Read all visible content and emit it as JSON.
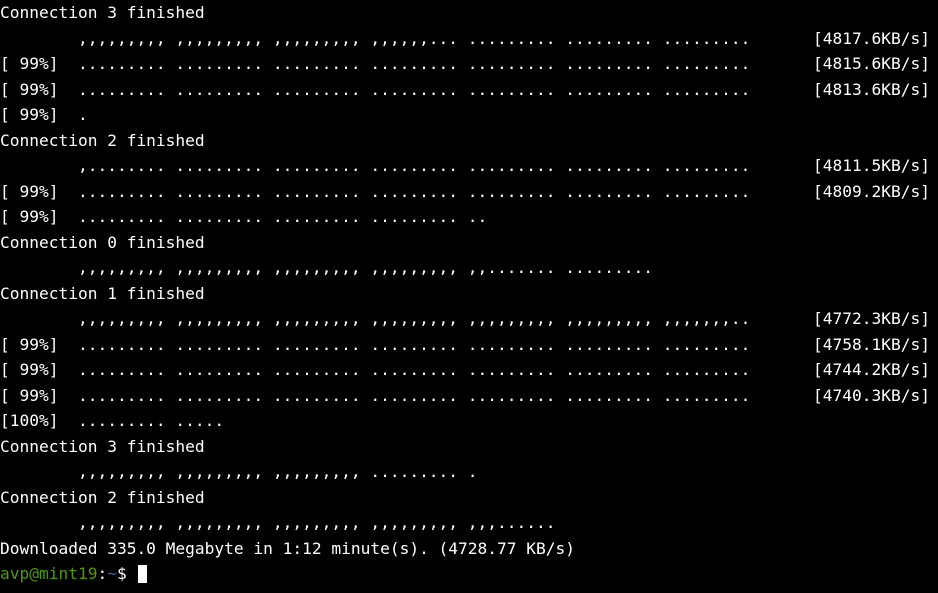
{
  "lines": [
    {
      "left": "Connection 3 finished",
      "right": ""
    },
    {
      "left": "        ,,,,,,,,, ,,,,,,,,, ,,,,,,,,, ,,,,,,... ......... ......... .........",
      "right": "[4817.6KB/s]"
    },
    {
      "left": "[ 99%]  ......... ......... ......... ......... ......... ......... .........",
      "right": "[4815.6KB/s]"
    },
    {
      "left": "[ 99%]  ......... ......... ......... ......... ......... ......... .........",
      "right": "[4813.6KB/s]"
    },
    {
      "left": "[ 99%]  .",
      "right": ""
    },
    {
      "left": "Connection 2 finished",
      "right": ""
    },
    {
      "left": "        ,........ ......... ......... ......... ......... ......... .........",
      "right": "[4811.5KB/s]"
    },
    {
      "left": "[ 99%]  ......... ......... ......... ......... ......... ......... .........",
      "right": "[4809.2KB/s]"
    },
    {
      "left": "[ 99%]  ......... ......... ......... ......... ..",
      "right": ""
    },
    {
      "left": "Connection 0 finished",
      "right": ""
    },
    {
      "left": "        ,,,,,,,,, ,,,,,,,,, ,,,,,,,,, ,,,,,,,,, ,,....... .........",
      "right": ""
    },
    {
      "left": "Connection 1 finished",
      "right": ""
    },
    {
      "left": "        ,,,,,,,,, ,,,,,,,,, ,,,,,,,,, ,,,,,,,,, ,,,,,,,,, ,,,,,,,,, ,,,,,,,..",
      "right": "[4772.3KB/s]"
    },
    {
      "left": "[ 99%]  ......... ......... ......... ......... ......... ......... .........",
      "right": "[4758.1KB/s]"
    },
    {
      "left": "[ 99%]  ......... ......... ......... ......... ......... ......... .........",
      "right": "[4744.2KB/s]"
    },
    {
      "left": "[ 99%]  ......... ......... ......... ......... ......... ......... .........",
      "right": "[4740.3KB/s]"
    },
    {
      "left": "[100%]  ......... .....",
      "right": ""
    },
    {
      "left": "Connection 3 finished",
      "right": ""
    },
    {
      "left": "        ,,,,,,,,, ,,,,,,,,, ,,,,,,,,, ......... .",
      "right": ""
    },
    {
      "left": "Connection 2 finished",
      "right": ""
    },
    {
      "left": "        ,,,,,,,,, ,,,,,,,,, ,,,,,,,,, ,,,,,,,,, ,,,......",
      "right": ""
    },
    {
      "left": "",
      "right": ""
    },
    {
      "left": "Downloaded 335.0 Megabyte in 1:12 minute(s). (4728.77 KB/s)",
      "right": ""
    }
  ],
  "prompt": {
    "user": "avp",
    "at": "@",
    "host": "mint19",
    "colon": ":",
    "path": "~",
    "dollar": "$"
  }
}
